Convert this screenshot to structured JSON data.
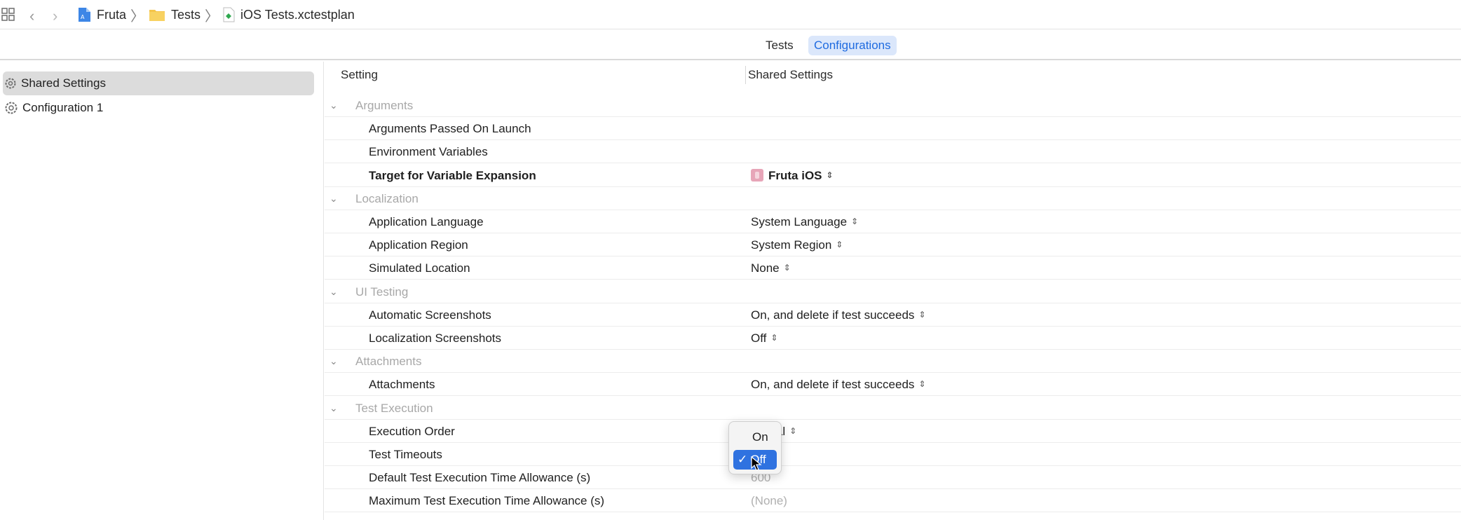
{
  "breadcrumb": [
    "Fruta",
    "Tests",
    "iOS Tests.xctestplan"
  ],
  "tabs": [
    {
      "label": "Tests",
      "selected": false
    },
    {
      "label": "Configurations",
      "selected": true
    }
  ],
  "sidebar": {
    "items": [
      {
        "label": "Shared Settings",
        "selected": true
      },
      {
        "label": "Configuration 1",
        "selected": false
      }
    ]
  },
  "table": {
    "headers": {
      "setting": "Setting",
      "shared": "Shared Settings"
    },
    "rows": [
      {
        "type": "section",
        "label": "Arguments"
      },
      {
        "type": "item",
        "label": "Arguments Passed On Launch",
        "value": ""
      },
      {
        "type": "item",
        "label": "Environment Variables",
        "value": ""
      },
      {
        "type": "item",
        "label": "Target for Variable Expansion",
        "value": "Fruta iOS",
        "bold": true,
        "icon": "app-target-icon"
      },
      {
        "type": "section",
        "label": "Localization"
      },
      {
        "type": "item",
        "label": "Application Language",
        "value": "System Language"
      },
      {
        "type": "item",
        "label": "Application Region",
        "value": "System Region"
      },
      {
        "type": "item",
        "label": "Simulated Location",
        "value": "None"
      },
      {
        "type": "section",
        "label": "UI Testing"
      },
      {
        "type": "item",
        "label": "Automatic Screenshots",
        "value": "On, and delete if test succeeds"
      },
      {
        "type": "item",
        "label": "Localization Screenshots",
        "value": "Off"
      },
      {
        "type": "section",
        "label": "Attachments"
      },
      {
        "type": "item",
        "label": "Attachments",
        "value": "On, and delete if test succeeds"
      },
      {
        "type": "section",
        "label": "Test Execution"
      },
      {
        "type": "item",
        "label": "Execution Order",
        "value": "betical"
      },
      {
        "type": "item",
        "label": "Test Timeouts",
        "value": ""
      },
      {
        "type": "item",
        "label": "Default Test Execution Time Allowance (s)",
        "value": "600",
        "dim": true
      },
      {
        "type": "item",
        "label": "Maximum Test Execution Time Allowance (s)",
        "value": "(None)",
        "dim": true
      }
    ]
  },
  "popup": {
    "options": [
      "On",
      "Off"
    ],
    "selected": "Off",
    "check": "✓"
  },
  "icons": {
    "updown": "⌃⌄",
    "chevron": "⌄"
  },
  "colors": {
    "accent": "#2f72e0",
    "tab_selected_bg": "#dbe7fb"
  }
}
